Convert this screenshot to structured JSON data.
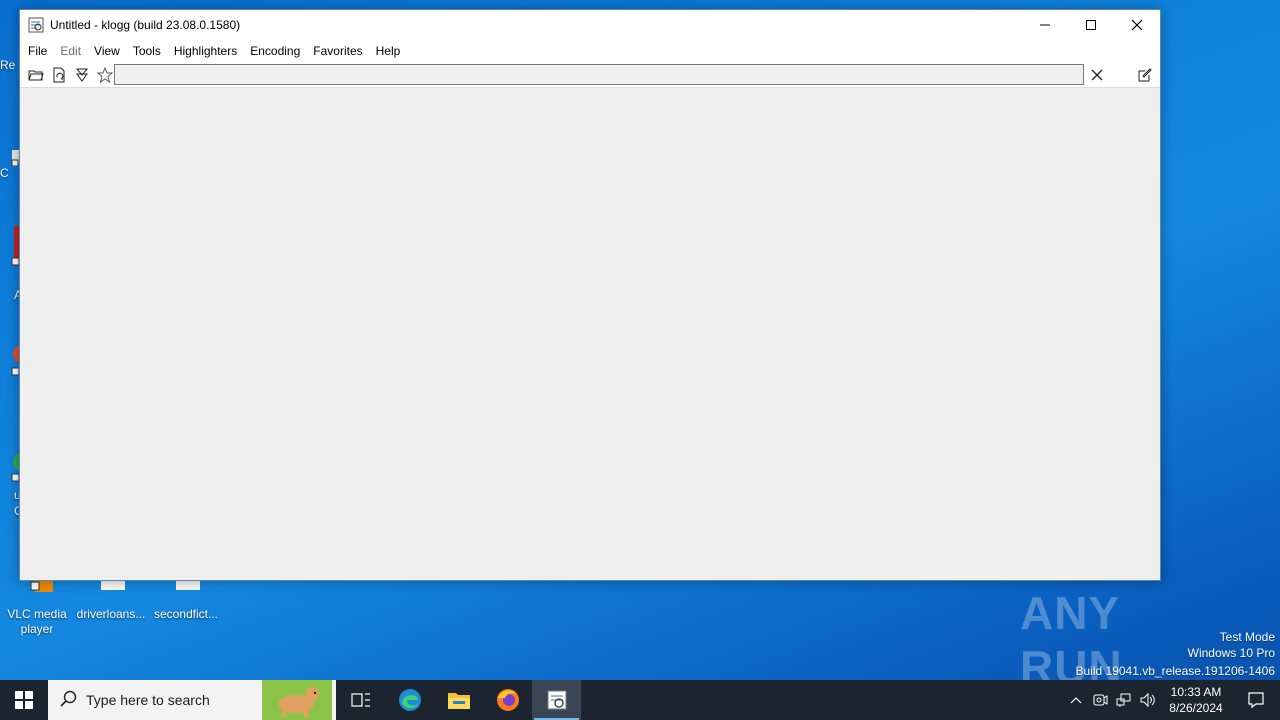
{
  "window": {
    "title": "Untitled - klogg (build 23.08.0.1580)"
  },
  "menu": {
    "file": "File",
    "edit": "Edit",
    "view": "View",
    "tools": "Tools",
    "highlighters": "Highlighters",
    "encoding": "Encoding",
    "favorites": "Favorites",
    "help": "Help"
  },
  "toolbar": {
    "search_value": ""
  },
  "desktop": {
    "sliver_labels": [
      "Re",
      "C",
      "A",
      "u",
      "C"
    ],
    "icons": [
      {
        "label": "VLC media player",
        "icon": "vlc-icon"
      },
      {
        "label": "driverloans...",
        "icon": "document-icon"
      },
      {
        "label": "secondfict...",
        "icon": "document-icon"
      }
    ]
  },
  "watermark": {
    "logo": "ANY RUN",
    "line1": "Test Mode",
    "line2": "Windows 10 Pro",
    "line3": "Build 19041.vb_release.191206-1406"
  },
  "taskbar": {
    "search_placeholder": "Type here to search",
    "time": "10:33 AM",
    "date": "8/26/2024",
    "apps": [
      "task-view-icon",
      "edge-icon",
      "file-explorer-icon",
      "firefox-icon",
      "klogg-icon"
    ]
  },
  "colors": {
    "desktop_blue": "#0f82dc",
    "taskbar": "#1c2430",
    "active_indicator": "#76b9ed"
  }
}
